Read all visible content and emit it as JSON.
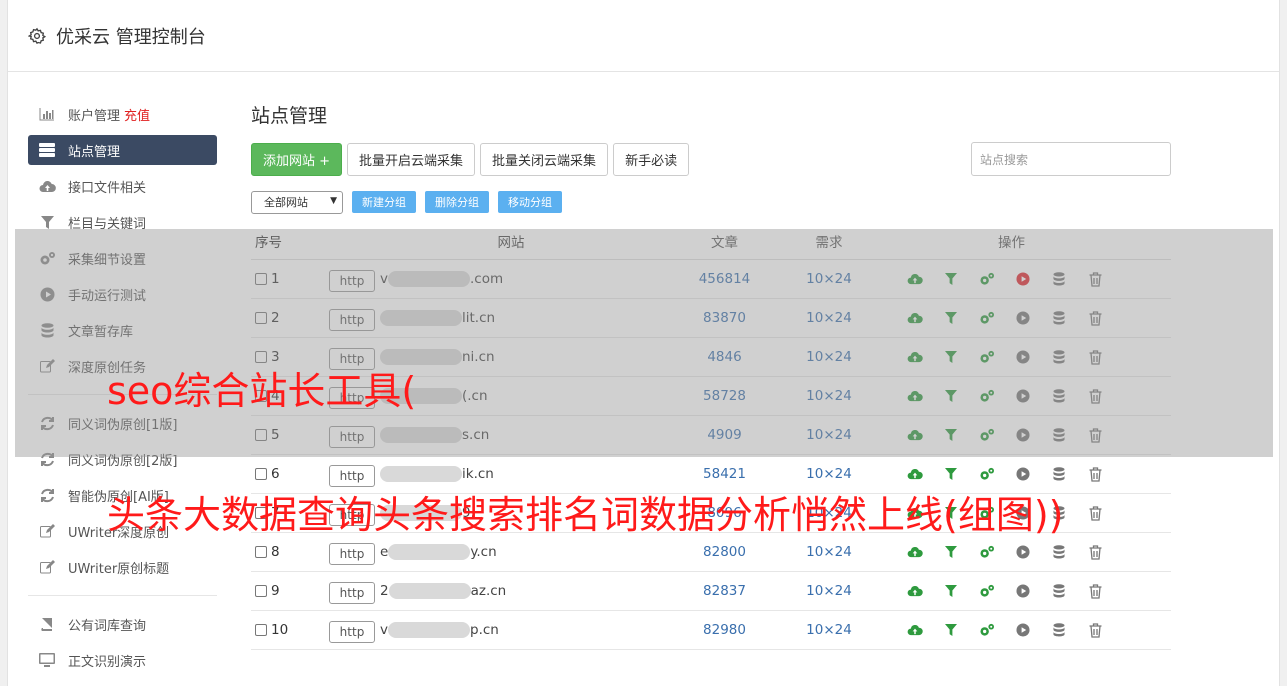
{
  "app": {
    "title": "优采云 管理控制台"
  },
  "sidebar": {
    "items": [
      {
        "label": "账户管理",
        "extra": "充值",
        "icon": "bar-chart-icon"
      },
      {
        "label": "站点管理",
        "icon": "server-list-icon",
        "active": true
      },
      {
        "label": "接口文件相关",
        "icon": "cloud-upload-icon"
      },
      {
        "label": "栏目与关键词",
        "icon": "filter-icon"
      },
      {
        "label": "采集细节设置",
        "icon": "gears-icon"
      },
      {
        "label": "手动运行测试",
        "icon": "play-circle-icon"
      },
      {
        "label": "文章暂存库",
        "icon": "database-icon"
      },
      {
        "label": "深度原创任务",
        "icon": "edit-icon"
      }
    ],
    "items2": [
      {
        "label": "同义词伪原创[1版]",
        "icon": "refresh-icon"
      },
      {
        "label": "同义词伪原创[2版]",
        "icon": "refresh-icon"
      },
      {
        "label": "智能伪原创[AI版]",
        "icon": "refresh-icon"
      },
      {
        "label": "UWriter深度原创",
        "icon": "edit-icon"
      },
      {
        "label": "UWriter原创标题",
        "icon": "edit-icon"
      }
    ],
    "items3": [
      {
        "label": "公有词库查询",
        "icon": "book-icon"
      },
      {
        "label": "正文识别演示",
        "icon": "monitor-icon"
      }
    ]
  },
  "main": {
    "title": "站点管理",
    "toolbar": {
      "add_site": "添加网站 +",
      "batch_enable": "批量开启云端采集",
      "batch_disable": "批量关闭云端采集",
      "newbie": "新手必读",
      "search_placeholder": "站点搜索"
    },
    "subtoolbar": {
      "group_select": "全部网站",
      "new_group": "新建分组",
      "delete_group": "删除分组",
      "move_group": "移动分组"
    },
    "table": {
      "headers": {
        "num": "序号",
        "site": "网站",
        "articles": "文章",
        "demand": "需求",
        "ops": "操作"
      },
      "http_label": "http",
      "rows": [
        {
          "num": "1",
          "site_prefix": "v",
          "site_suffix": ".com",
          "articles": "456814",
          "demand": "10×24",
          "running": true
        },
        {
          "num": "2",
          "site_prefix": "",
          "site_suffix": "lit.cn",
          "articles": "83870",
          "demand": "10×24",
          "running": false
        },
        {
          "num": "3",
          "site_prefix": "",
          "site_suffix": "ni.cn",
          "articles": "4846",
          "demand": "10×24",
          "running": false
        },
        {
          "num": "4",
          "site_prefix": "",
          "site_suffix": "(.cn",
          "articles": "58728",
          "demand": "10×24",
          "running": false
        },
        {
          "num": "5",
          "site_prefix": "",
          "site_suffix": "s.cn",
          "articles": "4909",
          "demand": "10×24",
          "running": false
        },
        {
          "num": "6",
          "site_prefix": "",
          "site_suffix": "ik.cn",
          "articles": "58421",
          "demand": "10×24",
          "running": false
        },
        {
          "num": "7",
          "site_prefix": "",
          "site_suffix": "9.",
          "articles": "8096",
          "demand": "10×24",
          "running": false
        },
        {
          "num": "8",
          "site_prefix": "e",
          "site_suffix": "y.cn",
          "articles": "82800",
          "demand": "10×24",
          "running": false
        },
        {
          "num": "9",
          "site_prefix": "2",
          "site_suffix": "az.cn",
          "articles": "82837",
          "demand": "10×24",
          "running": false
        },
        {
          "num": "10",
          "site_prefix": "v",
          "site_suffix": "p.cn",
          "articles": "82980",
          "demand": "10×24",
          "running": false
        }
      ]
    }
  },
  "overlay": {
    "line1": "seo综合站长工具(",
    "line2": "头条大数据查询头条搜索排名词数据分析悄然上线(组图))"
  },
  "colors": {
    "accent_green": "#5cb85c",
    "active_nav": "#3b4a63",
    "link_blue": "#3a6fad",
    "overlay_red": "#ff1a1a"
  }
}
